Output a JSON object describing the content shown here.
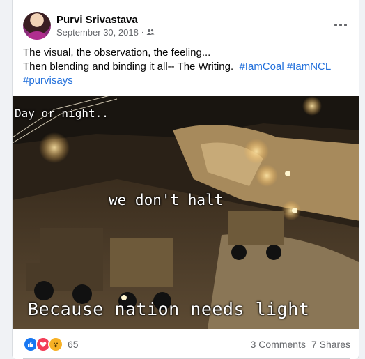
{
  "post": {
    "author": "Purvi Srivastava",
    "date": "September 30, 2018",
    "audience_icon": "friends-icon",
    "more_icon": "more-horizontal-icon",
    "text_line1": "The visual, the observation, the feeling...",
    "text_line2": "Then blending and binding it all-- The Writing.",
    "hashtags": [
      "#IamCoal",
      "#IamNCL",
      "#purvisays"
    ]
  },
  "image": {
    "caption_top": "Day or night..",
    "caption_middle": "we don't halt",
    "caption_bottom": "Because nation needs light"
  },
  "footer": {
    "reactions": [
      "like",
      "love",
      "wow"
    ],
    "reaction_count": "65",
    "comments": "3 Comments",
    "shares": "7 Shares"
  },
  "colors": {
    "link": "#216fdb",
    "like": "#1877f2",
    "love": "#f33e58",
    "wow": "#f7b125"
  }
}
